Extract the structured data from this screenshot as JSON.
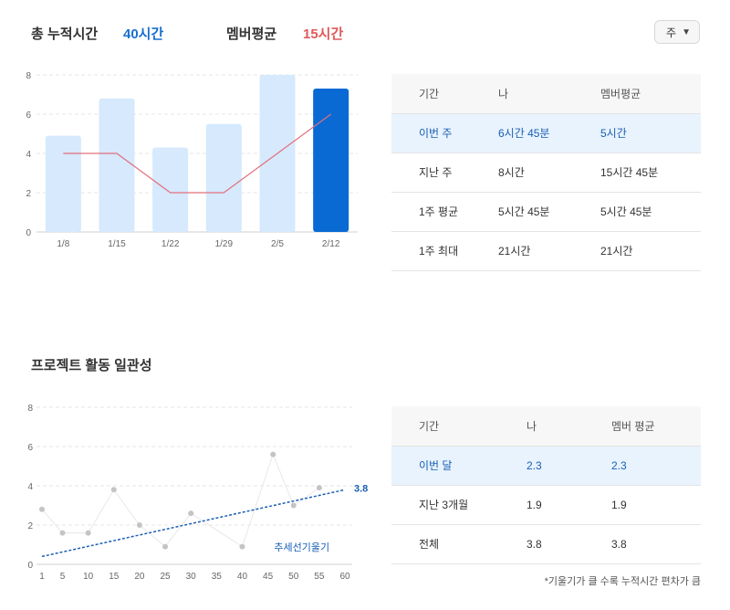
{
  "summary": {
    "total_label": "총 누적시간",
    "total_value": "40시간",
    "avg_label": "멤버평균",
    "avg_value": "15시간"
  },
  "period_select": {
    "value": "주"
  },
  "chart_data": [
    {
      "type": "bar",
      "categories": [
        "1/8",
        "1/15",
        "1/22",
        "1/29",
        "2/5",
        "2/12"
      ],
      "series": [
        {
          "values": [
            4.9,
            6.8,
            4.3,
            5.5,
            8.0,
            7.3
          ],
          "kind": "bar"
        },
        {
          "values": [
            4,
            4,
            2,
            2,
            4,
            6
          ],
          "kind": "line"
        }
      ],
      "ylim": [
        0,
        8
      ],
      "yticks": [
        0,
        2,
        4,
        6,
        8
      ],
      "highlight_index": 5,
      "colors": {
        "bar": "#d6e9fd",
        "bar_highlight": "#0a6ad4",
        "line": "#e2707c"
      },
      "grid": true
    },
    {
      "type": "scatter",
      "title": "프로젝트 활동 일관성",
      "x": [
        1,
        5,
        10,
        15,
        20,
        25,
        30,
        40,
        46,
        50,
        55
      ],
      "y": [
        2.8,
        1.6,
        1.6,
        3.8,
        2.0,
        0.9,
        2.6,
        0.9,
        5.6,
        3.0,
        3.9
      ],
      "xticks": [
        1,
        5,
        10,
        15,
        20,
        25,
        30,
        35,
        40,
        45,
        50,
        55,
        60
      ],
      "yticks": [
        0,
        2,
        4,
        6,
        8
      ],
      "xlim": [
        1,
        60
      ],
      "ylim": [
        0,
        8
      ],
      "trendline": {
        "from": [
          1,
          0.4
        ],
        "to": [
          60,
          3.8
        ],
        "label": "추세선기울기",
        "end_label": "3.8"
      },
      "colors": {
        "point": "#c4c4c4",
        "trend": "#1a5fb4"
      },
      "grid": true
    }
  ],
  "table1": {
    "headers": [
      "기간",
      "나",
      "멤버평균"
    ],
    "rows": [
      [
        "이번 주",
        "6시간 45분",
        "5시간"
      ],
      [
        "지난 주",
        "8시간",
        "15시간 45분"
      ],
      [
        "1주 평균",
        "5시간 45분",
        "5시간 45분"
      ],
      [
        "1주 최대",
        "21시간",
        "21시간"
      ]
    ]
  },
  "section2": {
    "title": "프로젝트 활동 일관성"
  },
  "table2": {
    "headers": [
      "기간",
      "나",
      "멤버 평균"
    ],
    "rows": [
      [
        "이번 달",
        "2.3",
        "2.3"
      ],
      [
        "지난 3개월",
        "1.9",
        "1.9"
      ],
      [
        "전체",
        "3.8",
        "3.8"
      ]
    ]
  },
  "footnote": "*기울기가 클 수록 누적시간 편차가 큼"
}
